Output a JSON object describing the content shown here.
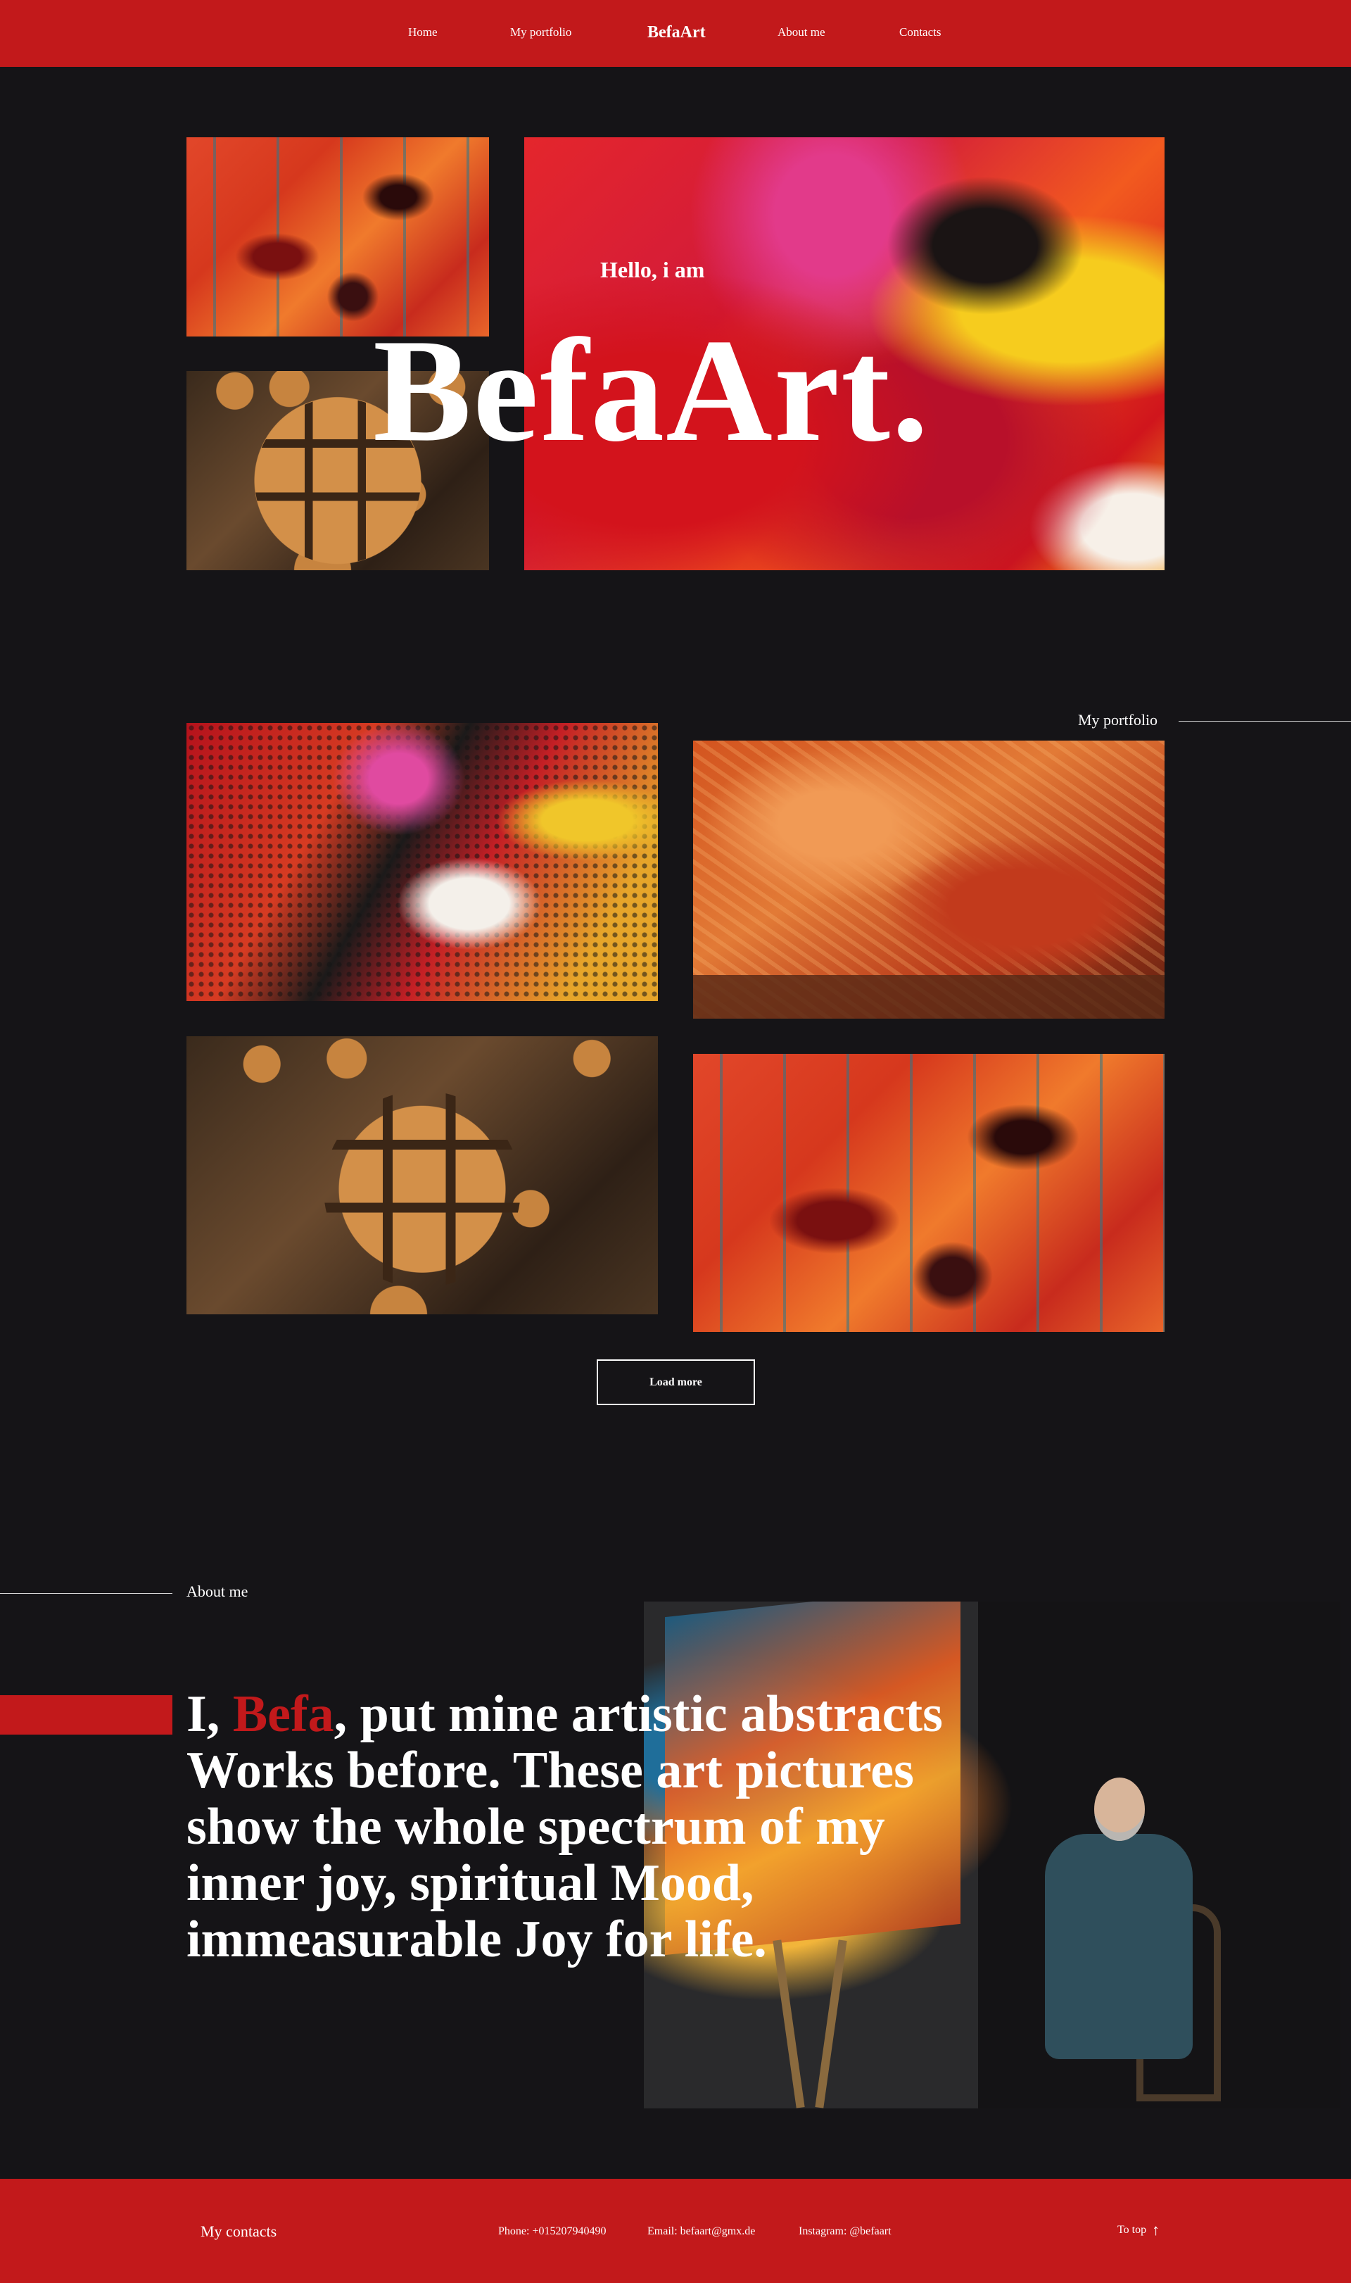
{
  "nav": {
    "items": [
      "Home",
      "My portfolio",
      "BefaArt",
      "About me",
      "Contacts"
    ]
  },
  "hero": {
    "subtitle": "Hello, i am",
    "title": "BefaArt."
  },
  "portfolio": {
    "label": "My portfolio",
    "load_more": "Load more"
  },
  "about": {
    "label": "About me",
    "text_before": "I, ",
    "highlight": "Befa",
    "text_after": ", put mine artistic abstracts Works before. These art pictures show the whole spectrum of my inner joy, spiritual Mood, immeasurable Joy for life."
  },
  "footer": {
    "title": "My contacts",
    "phone": "Phone: +015207940490",
    "email": "Email: befaart@gmx.de",
    "instagram": "Instagram: @befaart",
    "to_top": "To top",
    "to_top_icon": "arrow-up-icon"
  },
  "colors": {
    "accent": "#c2191b",
    "background": "#151417",
    "text": "#ffffff"
  }
}
